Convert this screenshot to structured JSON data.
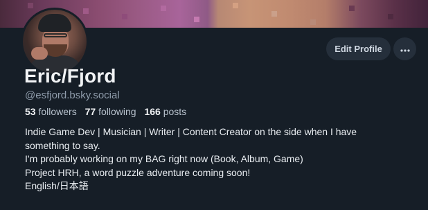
{
  "profile": {
    "display_name": "Eric/Fjord",
    "handle": "@esfjord.bsky.social",
    "stats": {
      "followers_count": "53",
      "followers_label": "followers",
      "following_count": "77",
      "following_label": "following",
      "posts_count": "166",
      "posts_label": "posts"
    },
    "bio_lines": [
      "Indie Game Dev | Musician | Writer | Content Creator on the side when I have",
      "something to say.",
      "I'm probably working on my BAG right now (Book, Album, Game)",
      "Project HRH, a word puzzle adventure coming soon!",
      "English/日本語"
    ]
  },
  "actions": {
    "edit_profile_label": "Edit Profile",
    "more_icon": "ellipsis-icon"
  },
  "colors": {
    "background": "#161e27",
    "button_bg": "#252f3b",
    "muted_text": "#8f9cab"
  }
}
